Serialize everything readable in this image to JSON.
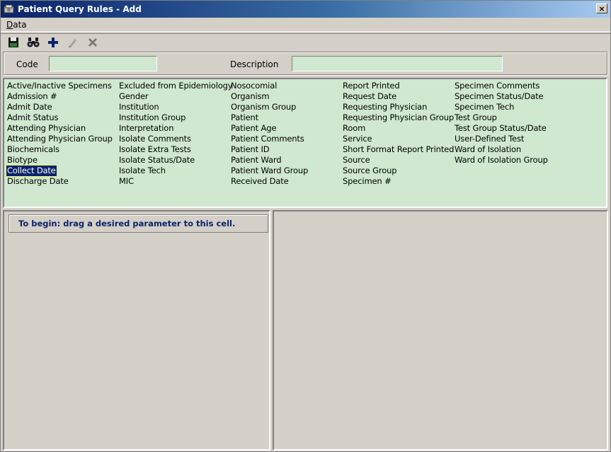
{
  "window": {
    "title": "Patient Query Rules - Add",
    "close_label": "×",
    "icons": {
      "app": "app-window-icon",
      "close": "close-icon"
    }
  },
  "menubar": {
    "items": [
      {
        "label_underlined": "D",
        "label_rest": "ata"
      }
    ]
  },
  "toolbar": {
    "buttons": [
      {
        "icon": "save-icon"
      },
      {
        "icon": "find-icon"
      },
      {
        "icon": "add-icon"
      },
      {
        "icon": "edit-icon"
      },
      {
        "icon": "delete-icon"
      }
    ]
  },
  "form": {
    "code_label": "Code",
    "code_value": "",
    "description_label": "Description",
    "description_value": "",
    "field_color": "#cfe8cf"
  },
  "parameters": {
    "selected": "Collect Date",
    "columns": [
      [
        "Active/Inactive Specimens",
        "Admission #",
        "Admit Date",
        "Admit Status",
        "Attending Physician",
        "Attending Physician Group",
        "Biochemicals",
        "Biotype",
        "Collect Date",
        "Discharge Date"
      ],
      [
        "Excluded from Epidemiology",
        "Gender",
        "Institution",
        "Institution Group",
        "Interpretation",
        "Isolate Comments",
        "Isolate Extra Tests",
        "Isolate Status/Date",
        "Isolate Tech",
        "MIC"
      ],
      [
        "Nosocomial",
        "Organism",
        "Organism Group",
        "Patient",
        "Patient Age",
        "Patient Comments",
        "Patient ID",
        "Patient Ward",
        "Patient Ward Group",
        "Received Date"
      ],
      [
        "Report Printed",
        "Request Date",
        "Requesting Physician",
        "Requesting Physician Group",
        "Room",
        "Service",
        "Short Format Report Printed",
        "Source",
        "Source Group",
        "Specimen #"
      ],
      [
        "Specimen Comments",
        "Specimen Status/Date",
        "Specimen Tech",
        "Test Group",
        "Test Group Status/Date",
        "User-Defined Test",
        "Ward of Isolation",
        "Ward of Isolation Group"
      ]
    ]
  },
  "rule_builder": {
    "prompt": "To begin: drag a desired parameter to this cell.",
    "prompt_color": "#0a246a"
  }
}
